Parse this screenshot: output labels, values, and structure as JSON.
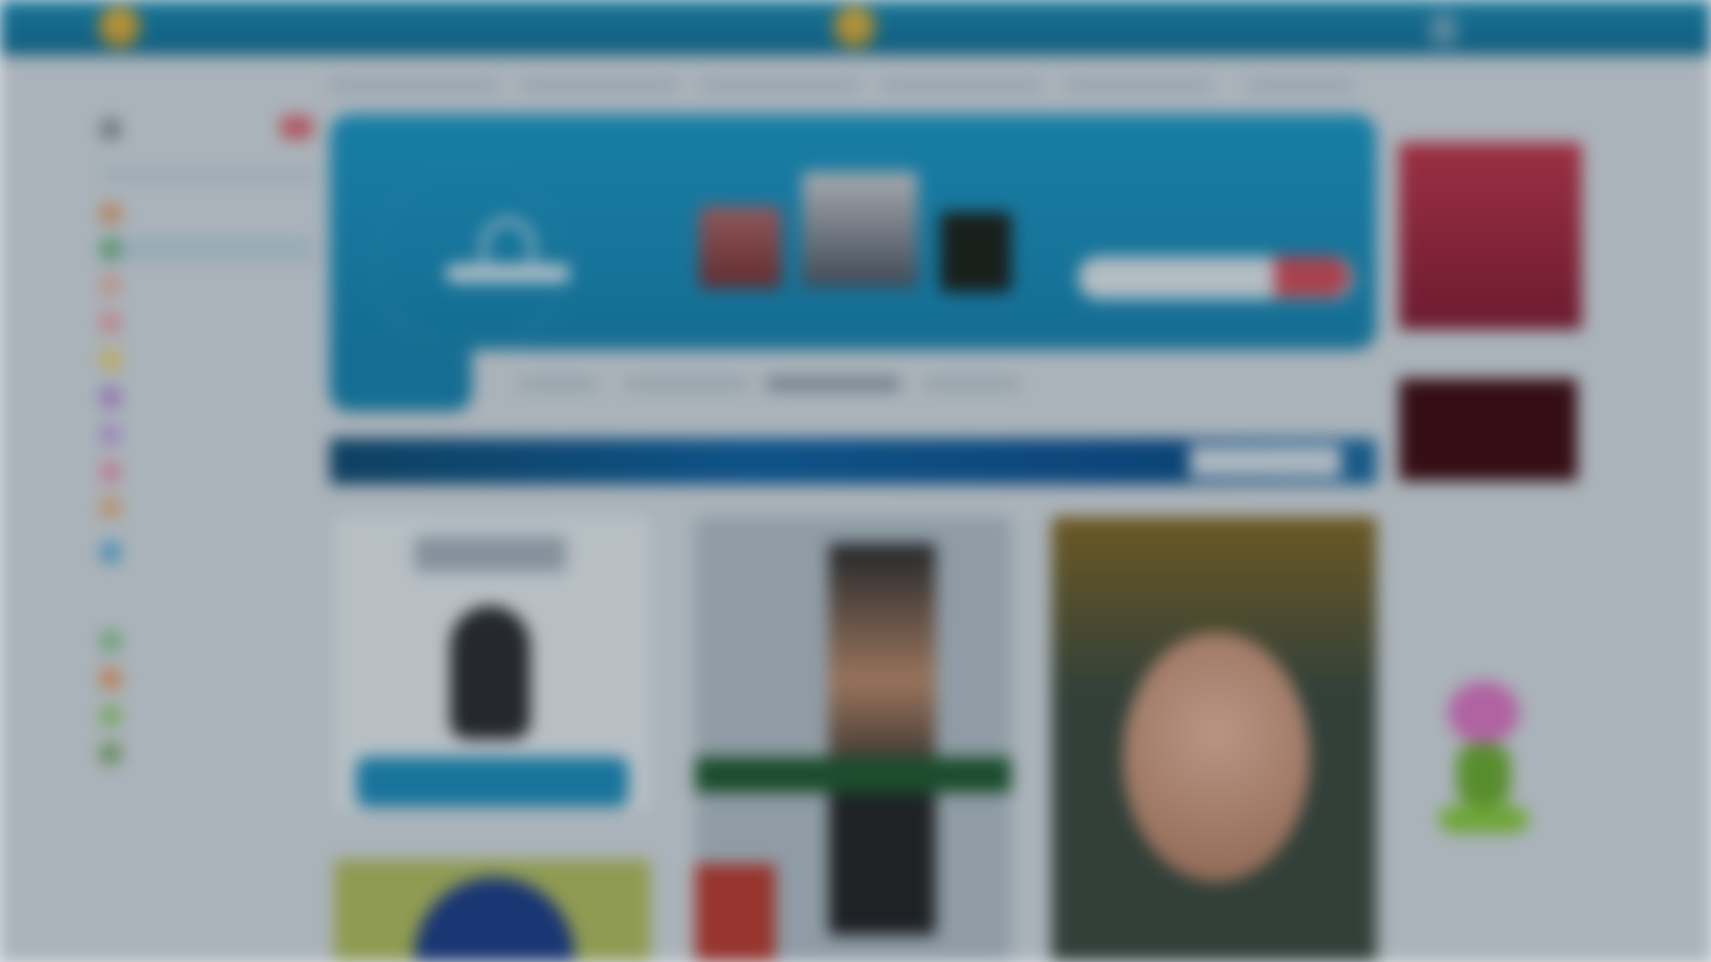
{
  "topbar": {
    "links": [
      "",
      "",
      "",
      "",
      "",
      ""
    ],
    "colors": {
      "background": "#1582ad",
      "badge": "#e0b43a"
    }
  },
  "subnav": {
    "items": [
      "",
      "",
      "",
      "",
      "",
      ""
    ]
  },
  "sidebar": {
    "section_titles": [
      "",
      ""
    ],
    "items": [
      {
        "label": "",
        "icon": "user-icon",
        "color": "#8a8f96"
      },
      {
        "label": "",
        "icon": "home-icon",
        "color": "#e6a06a"
      },
      {
        "label": "",
        "icon": "star-icon",
        "color": "#6fb67a",
        "active": true
      },
      {
        "label": "",
        "icon": "photo-icon",
        "color": "#f0b6a4"
      },
      {
        "label": "",
        "icon": "heart-icon",
        "color": "#f5a2a8"
      },
      {
        "label": "",
        "icon": "music-icon",
        "color": "#f4d66a"
      },
      {
        "label": "",
        "icon": "video-icon",
        "color": "#b78bd9"
      },
      {
        "label": "",
        "icon": "chat-icon",
        "color": "#c7a2e8"
      },
      {
        "label": "",
        "icon": "game-icon",
        "color": "#f098b0"
      },
      {
        "label": "",
        "icon": "gift-icon",
        "color": "#f0b27a"
      },
      {
        "label": "",
        "icon": "mail-icon",
        "color": "#5ab0de"
      },
      {
        "label": "",
        "icon": "group-icon",
        "color": "#86c88c"
      },
      {
        "label": "",
        "icon": "fire-icon",
        "color": "#f29a5c"
      },
      {
        "label": "",
        "icon": "leaf-icon",
        "color": "#9ad16e"
      },
      {
        "label": "",
        "icon": "tree-icon",
        "color": "#7da860"
      }
    ],
    "links": [
      "",
      ""
    ],
    "badge_color": "#e56873"
  },
  "hero": {
    "title": "",
    "subtitle": "",
    "search": {
      "value": "",
      "placeholder": ""
    },
    "search_button": "",
    "tabs": [
      "",
      "",
      "",
      ""
    ],
    "logo_icon": "tent-logo-icon",
    "accent": "#1a9ccc",
    "search_button_color": "#d84e5a"
  },
  "banner": {
    "text": "",
    "button_label": ""
  },
  "cards": [
    {
      "heading": "",
      "cta_label": "",
      "image": "silhouette-portrait"
    },
    {
      "image": "person-photo"
    },
    {
      "image": "painted-portrait"
    },
    {
      "image": "cartoon-portrait"
    }
  ],
  "right_column": {
    "title": "",
    "ad_images": [
      "red-crowd-ad",
      "dark-red-ad"
    ],
    "links": [
      "",
      ""
    ],
    "text_blocks": [
      "",
      ""
    ],
    "mascot_icon": "flower-mascot-icon"
  }
}
